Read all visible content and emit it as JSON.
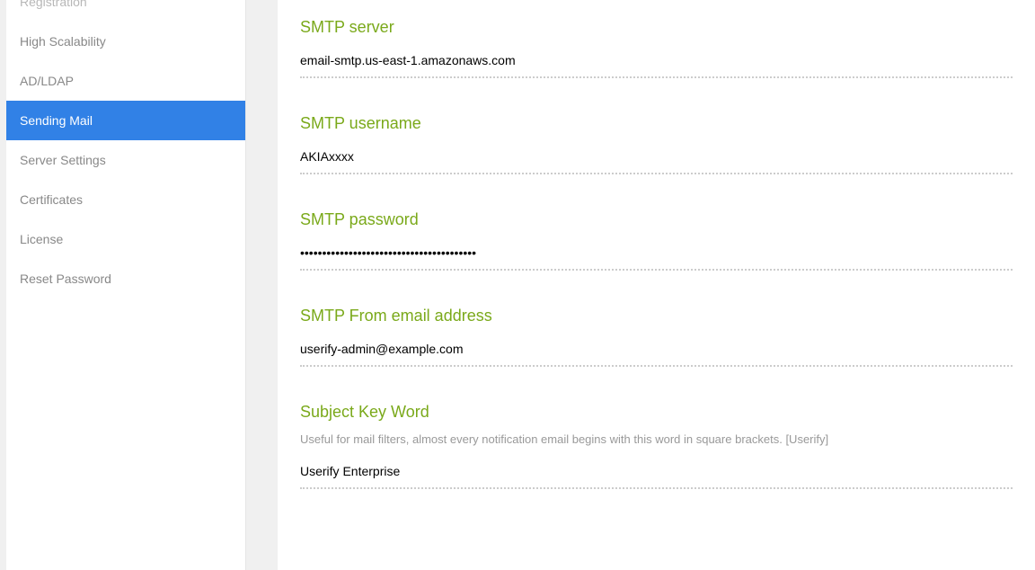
{
  "sidebar": {
    "items": [
      {
        "label": "Registration",
        "active": false
      },
      {
        "label": "High Scalability",
        "active": false
      },
      {
        "label": "AD/LDAP",
        "active": false
      },
      {
        "label": "Sending Mail",
        "active": true
      },
      {
        "label": "Server Settings",
        "active": false
      },
      {
        "label": "Certificates",
        "active": false
      },
      {
        "label": "License",
        "active": false
      },
      {
        "label": "Reset Password",
        "active": false
      }
    ]
  },
  "form": {
    "smtp_server": {
      "label": "SMTP server",
      "value": "email-smtp.us-east-1.amazonaws.com"
    },
    "smtp_username": {
      "label": "SMTP username",
      "value": "AKIAxxxx"
    },
    "smtp_password": {
      "label": "SMTP password",
      "value": "xxxxxxxxxxxxxxxxxxxxxxxxxxxxxxxxxxxxxxxx"
    },
    "smtp_from": {
      "label": "SMTP From email address",
      "value": "userify-admin@example.com"
    },
    "subject_keyword": {
      "label": "Subject Key Word",
      "help": "Useful for mail filters, almost every notification email begins with this word in square brackets. [Userify]",
      "value": "Userify Enterprise"
    }
  }
}
